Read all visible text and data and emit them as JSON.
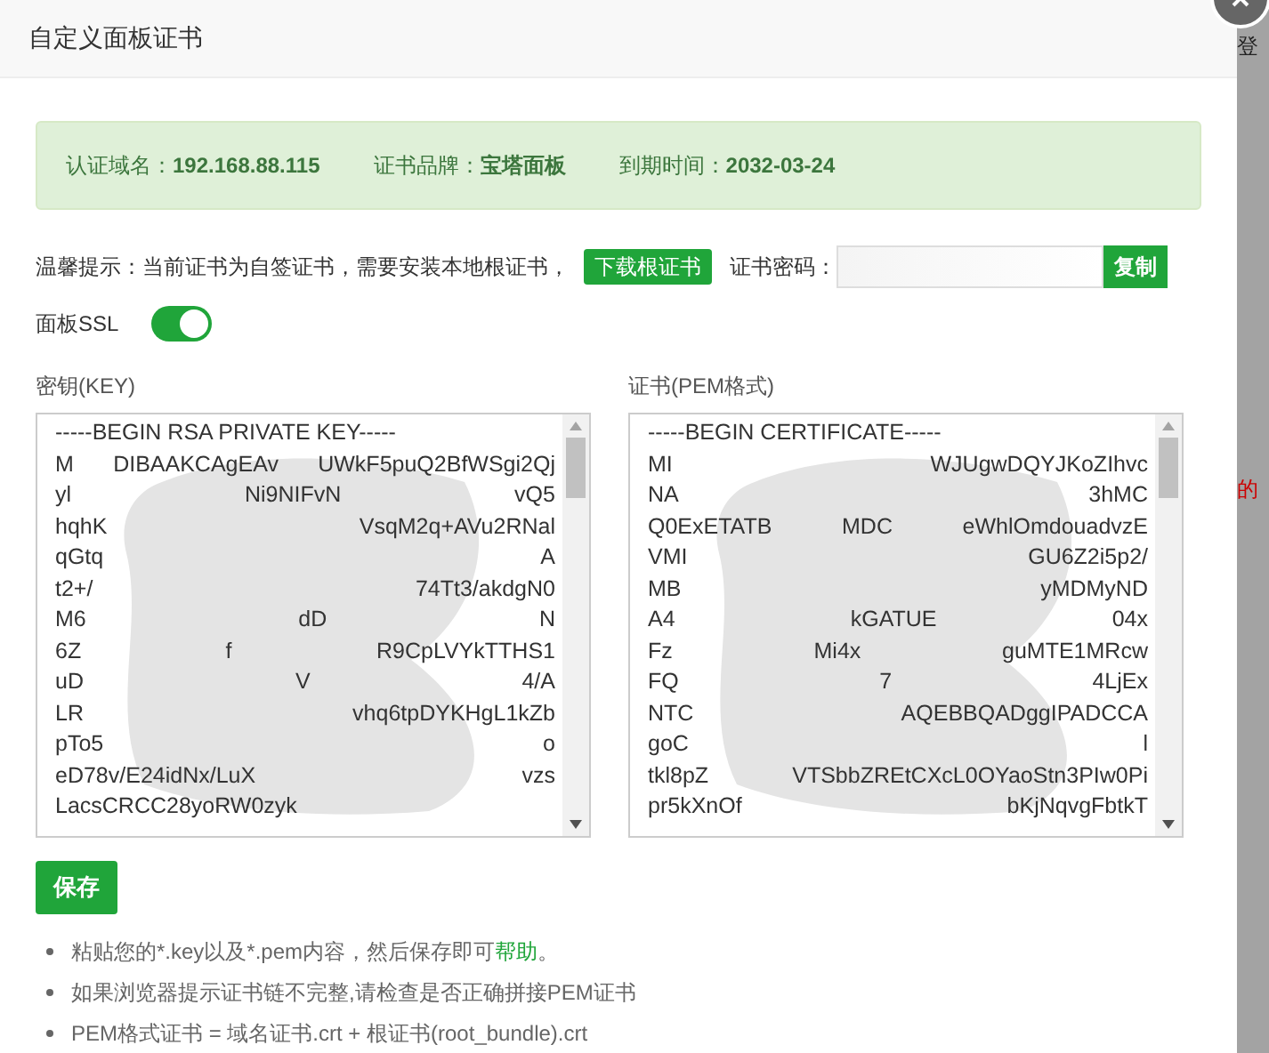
{
  "dialog": {
    "title": "自定义面板证书"
  },
  "cert_info": [
    {
      "label": "认证域名：",
      "value": "192.168.88.115"
    },
    {
      "label": "证书品牌：",
      "value": "宝塔面板"
    },
    {
      "label": "到期时间：",
      "value": "2032-03-24"
    }
  ],
  "tip": {
    "text": "温馨提示：当前证书为自签证书，需要安装本地根证书，",
    "download_button": "下载根证书",
    "password_label": "证书密码：",
    "copy_button": "复制"
  },
  "panel_ssl": {
    "label": "面板SSL",
    "on": true
  },
  "key_box": {
    "label": "密钥(KEY)",
    "lines": [
      [
        "-----BEGIN RSA PRIVATE KEY-----"
      ],
      [
        "M",
        "DIBAAKCAgEAv",
        "UWkF5puQ2BfWSgi2Qj"
      ],
      [
        "yl",
        "Ni9NIFvN",
        "vQ5"
      ],
      [
        "hqhK",
        "VsqM2q+AVu2RNal"
      ],
      [
        "qGtq",
        "A"
      ],
      [
        "t2+/",
        "74Tt3/akdgN0"
      ],
      [
        "M6",
        "dD",
        "N"
      ],
      [
        "6Z",
        "f",
        "R9CpLVYkTTHS1"
      ],
      [
        "uD",
        "V",
        "4/A"
      ],
      [
        "LR",
        "vhq6tpDYKHgL1kZb"
      ],
      [
        "pTo5",
        "o"
      ],
      [
        "eD78v/E24idNx/LuX",
        "vzs"
      ],
      [
        "LacsCRCC28yoRW0zyk"
      ]
    ]
  },
  "cert_box": {
    "label": "证书(PEM格式)",
    "lines": [
      [
        "-----BEGIN CERTIFICATE-----"
      ],
      [
        "MI",
        "WJUgwDQYJKoZIhvc"
      ],
      [
        "NA",
        "3hMC"
      ],
      [
        "Q0ExETATB",
        "MDC",
        "eWhlOmdouadvzE"
      ],
      [
        "VMI",
        "GU6Z2i5p2/"
      ],
      [
        "MB",
        "yMDMyND"
      ],
      [
        "A4",
        "kGATUE",
        "04x"
      ],
      [
        "Fz",
        "Mi4x",
        "guMTE1MRcw"
      ],
      [
        "FQ",
        "7",
        "4LjEx"
      ],
      [
        "NTC",
        "AQEBBQADggIPADCCA"
      ],
      [
        "goC",
        "l"
      ],
      [
        "tkl8pZ",
        "VTSbbZREtCXcL0OYaoStn3PIw0Pi"
      ],
      [
        "pr5kXnOf",
        "bKjNqvgFbtkT"
      ]
    ]
  },
  "save_button": "保存",
  "notes": [
    {
      "text": "粘贴您的*.key以及*.pem内容，然后保存即可",
      "link": "帮助",
      "tail": "。"
    },
    {
      "text": "如果浏览器提示证书链不完整,请检查是否正确拼接PEM证书"
    },
    {
      "text": "PEM格式证书 = 域名证书.crt + 根证书(root_bundle).crt"
    }
  ],
  "background_texts": [
    "登",
    "的"
  ]
}
